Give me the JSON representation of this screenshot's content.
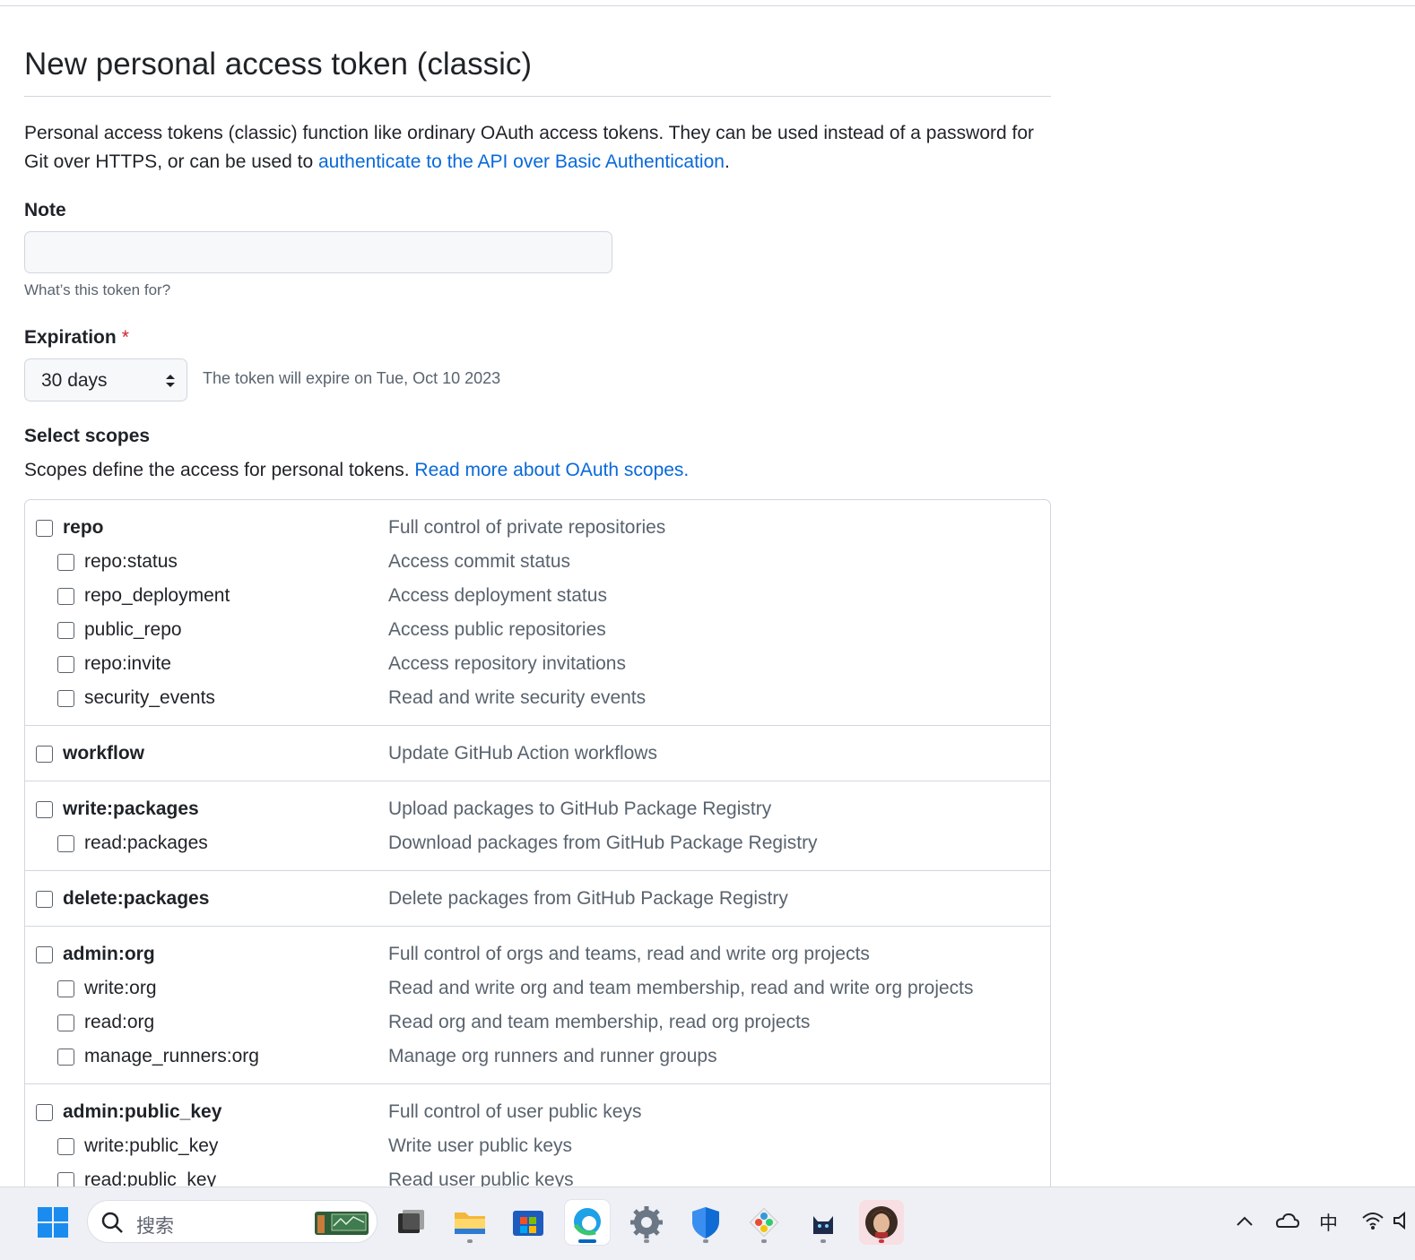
{
  "page": {
    "title": "New personal access token (classic)",
    "intro_text": "Personal access tokens (classic) function like ordinary OAuth access tokens. They can be used instead of a password for Git over HTTPS, or can be used to ",
    "intro_link": "authenticate to the API over Basic Authentication",
    "intro_end": "."
  },
  "note": {
    "label": "Note",
    "value": "",
    "placeholder": "",
    "hint": "What’s this token for?"
  },
  "expiration": {
    "label": "Expiration",
    "required_mark": "*",
    "selected": "30 days",
    "expire_text": "The token will expire on Tue, Oct 10 2023"
  },
  "scopes": {
    "label": "Select scopes",
    "desc": "Scopes define the access for personal tokens. ",
    "desc_link": "Read more about OAuth scopes.",
    "groups": [
      {
        "name": "repo",
        "desc": "Full control of private repositories",
        "checked": false,
        "children": [
          {
            "name": "repo:status",
            "desc": "Access commit status",
            "checked": false
          },
          {
            "name": "repo_deployment",
            "desc": "Access deployment status",
            "checked": false
          },
          {
            "name": "public_repo",
            "desc": "Access public repositories",
            "checked": false
          },
          {
            "name": "repo:invite",
            "desc": "Access repository invitations",
            "checked": false
          },
          {
            "name": "security_events",
            "desc": "Read and write security events",
            "checked": false
          }
        ]
      },
      {
        "name": "workflow",
        "desc": "Update GitHub Action workflows",
        "checked": false,
        "children": []
      },
      {
        "name": "write:packages",
        "desc": "Upload packages to GitHub Package Registry",
        "checked": false,
        "children": [
          {
            "name": "read:packages",
            "desc": "Download packages from GitHub Package Registry",
            "checked": false
          }
        ]
      },
      {
        "name": "delete:packages",
        "desc": "Delete packages from GitHub Package Registry",
        "checked": false,
        "children": []
      },
      {
        "name": "admin:org",
        "desc": "Full control of orgs and teams, read and write org projects",
        "checked": false,
        "children": [
          {
            "name": "write:org",
            "desc": "Read and write org and team membership, read and write org projects",
            "checked": false
          },
          {
            "name": "read:org",
            "desc": "Read org and team membership, read org projects",
            "checked": false
          },
          {
            "name": "manage_runners:org",
            "desc": "Manage org runners and runner groups",
            "checked": false
          }
        ]
      },
      {
        "name": "admin:public_key",
        "desc": "Full control of user public keys",
        "checked": false,
        "children": [
          {
            "name": "write:public_key",
            "desc": "Write user public keys",
            "checked": false
          },
          {
            "name": "read:public_key",
            "desc": "Read user public keys",
            "checked": false
          }
        ]
      }
    ]
  },
  "taskbar": {
    "search_placeholder": "搜索",
    "ime_indicator": "中",
    "apps": [
      "windows-start-icon",
      "task-view-icon",
      "file-explorer-icon",
      "microsoft-store-icon",
      "edge-browser-icon",
      "settings-icon",
      "defender-shield-icon",
      "git-tool-icon",
      "cat-app-icon",
      "avatar-app-icon"
    ],
    "colors": {
      "accent": "#0969da",
      "border": "#d0d7de",
      "muted": "#59636e",
      "required": "#cf222e"
    }
  }
}
